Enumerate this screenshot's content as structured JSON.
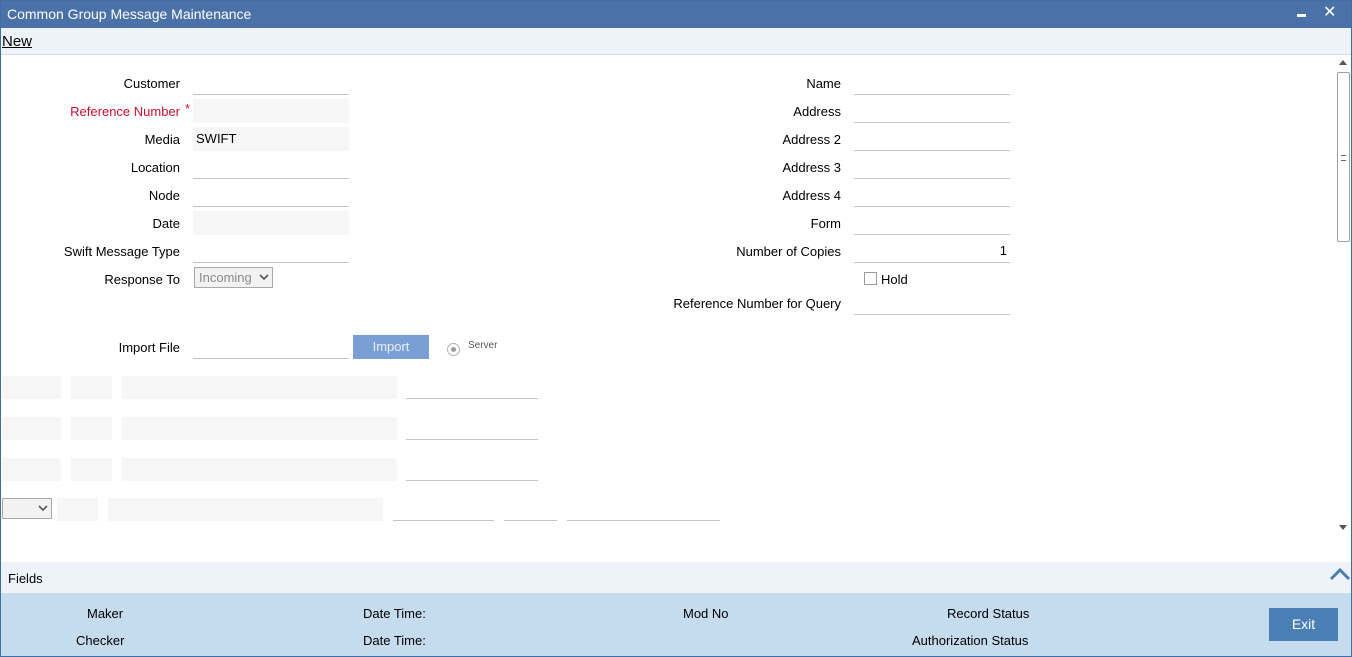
{
  "window": {
    "title": "Common Group Message Maintenance",
    "minimize_icon": "minimize-icon",
    "close_icon": "close-icon",
    "close_glyph": "✕"
  },
  "toolbar": {
    "new_label": "New"
  },
  "left_form": {
    "customer": {
      "label": "Customer",
      "value": ""
    },
    "reference_number": {
      "label": "Reference Number",
      "required_mark": "*",
      "value": ""
    },
    "media": {
      "label": "Media",
      "value": "SWIFT"
    },
    "location": {
      "label": "Location",
      "value": ""
    },
    "node": {
      "label": "Node",
      "value": ""
    },
    "date": {
      "label": "Date",
      "value": ""
    },
    "swift_message_type": {
      "label": "Swift Message Type",
      "value": ""
    },
    "response_to": {
      "label": "Response To",
      "value": "Incoming"
    }
  },
  "right_form": {
    "name": {
      "label": "Name",
      "value": ""
    },
    "address": {
      "label": "Address",
      "value": ""
    },
    "address2": {
      "label": "Address 2",
      "value": ""
    },
    "address3": {
      "label": "Address 3",
      "value": ""
    },
    "address4": {
      "label": "Address 4",
      "value": ""
    },
    "form": {
      "label": "Form",
      "value": ""
    },
    "number_of_copies": {
      "label": "Number of Copies",
      "value": "1"
    },
    "hold": {
      "label": "Hold",
      "checked": false
    },
    "reference_number_for_query": {
      "label": "Reference Number for Query",
      "value": ""
    }
  },
  "import": {
    "label": "Import File",
    "value": "",
    "button_label": "Import",
    "radio_label": "Server",
    "radio_selected": true
  },
  "fields_section": {
    "label": "Fields",
    "toggle_icon": "chevron-up-icon"
  },
  "footer": {
    "maker": "Maker",
    "checker": "Checker",
    "date_time_1": "Date Time:",
    "date_time_2": "Date Time:",
    "mod_no": "Mod No",
    "record_status": "Record Status",
    "authorization_status": "Authorization Status",
    "exit_label": "Exit"
  },
  "colors": {
    "title_bar": "#4a71a8",
    "required_label": "#c8102e",
    "footer_bg": "#c5dbee",
    "exit_button": "#4a7fb4",
    "import_button": "#7a9fd4"
  }
}
